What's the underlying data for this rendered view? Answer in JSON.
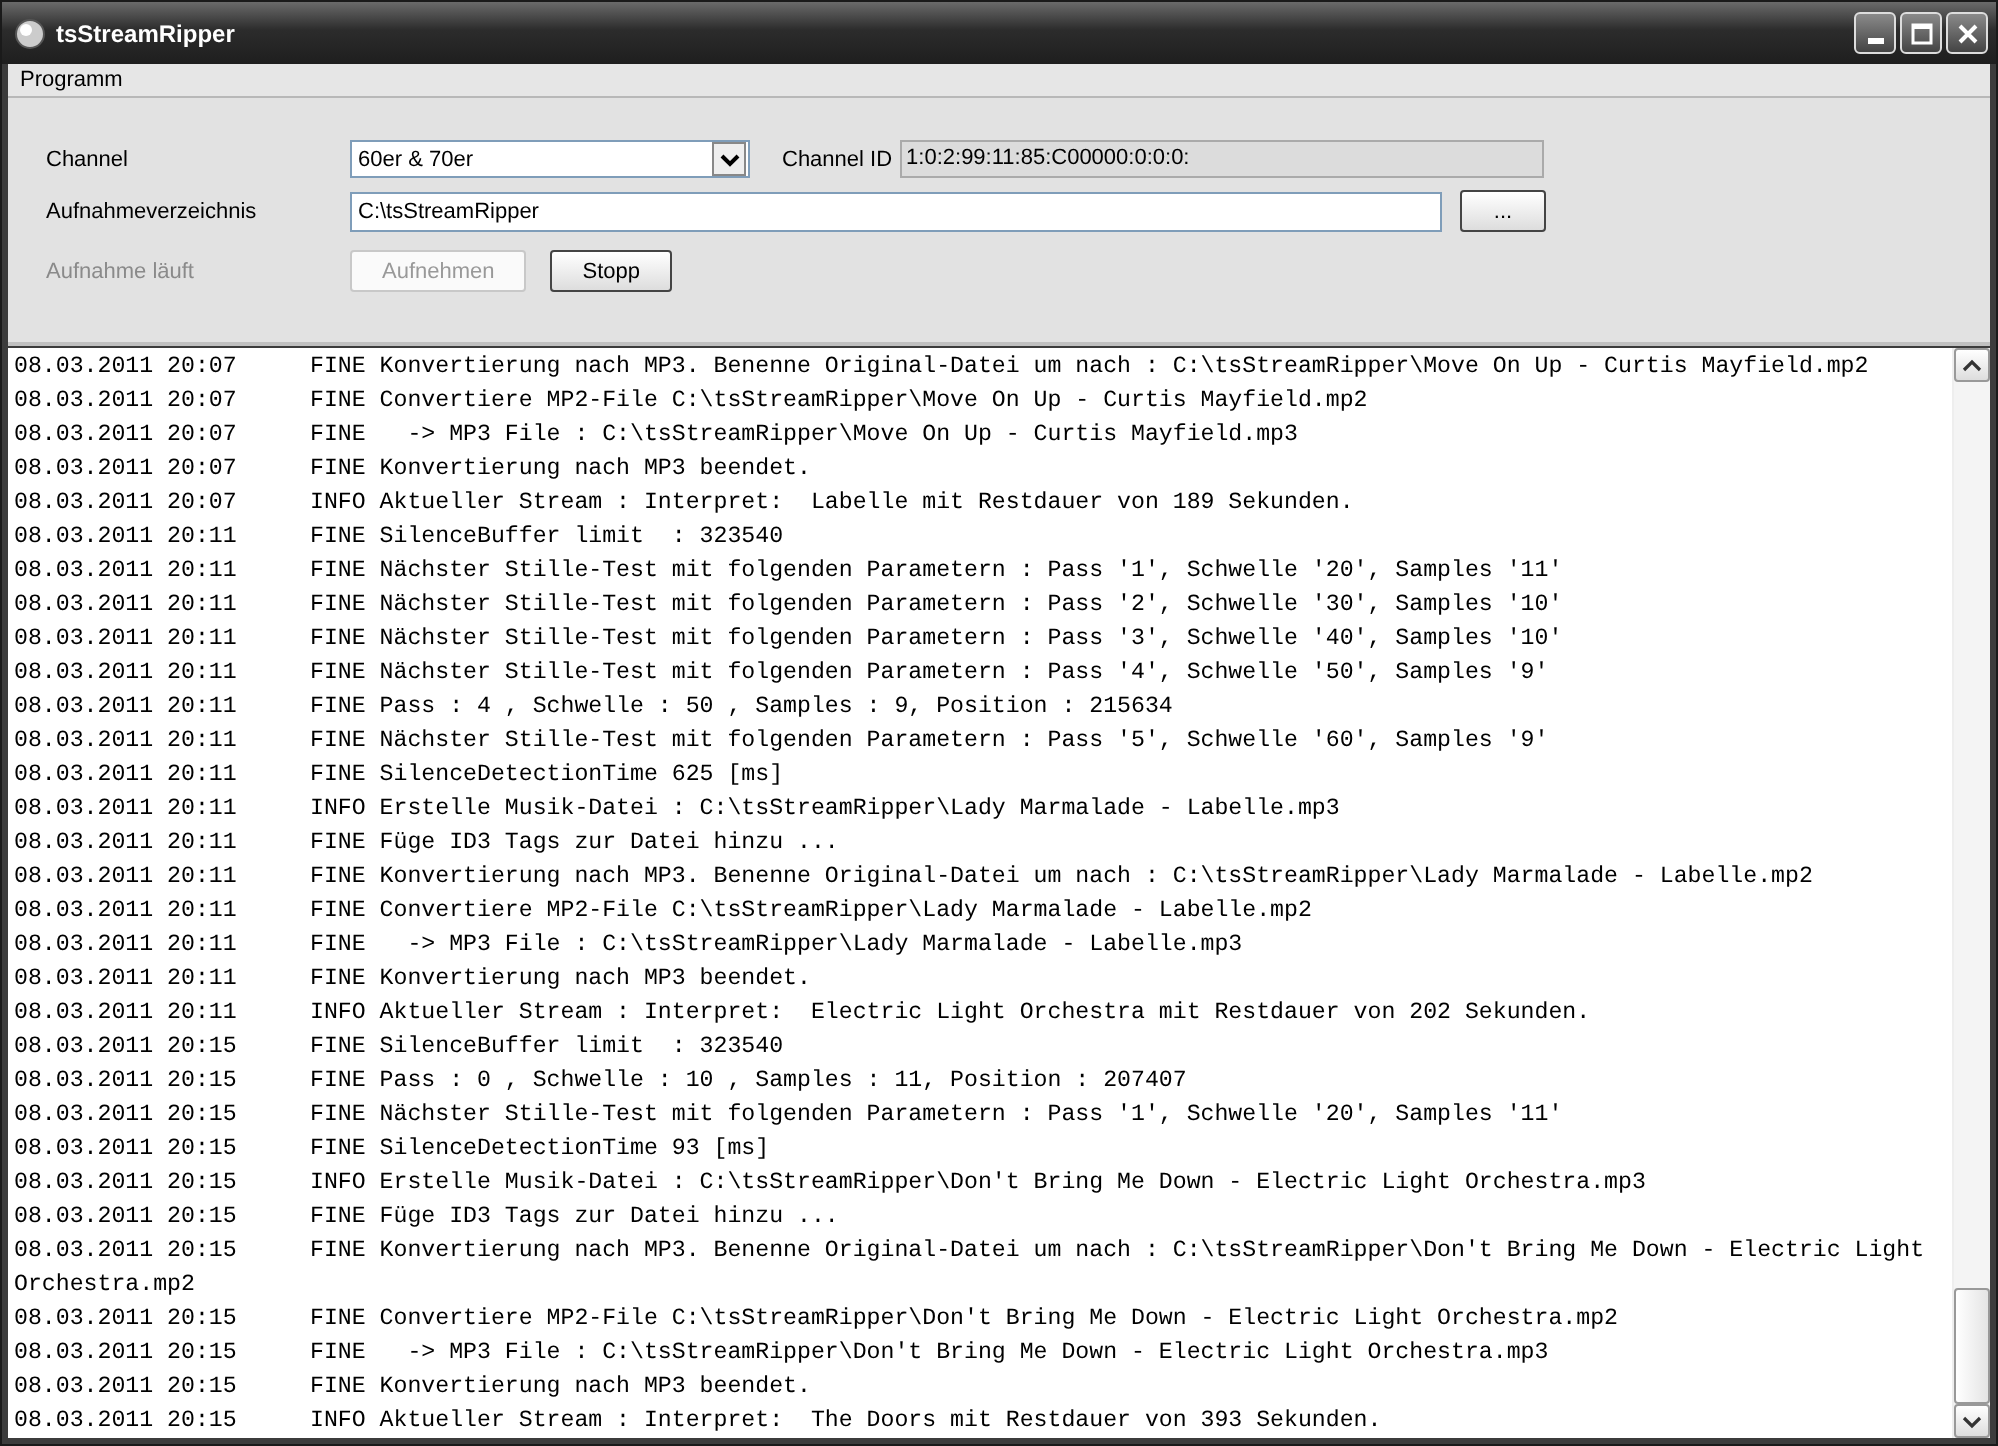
{
  "window": {
    "title": "tsStreamRipper"
  },
  "menu": [
    "Programm"
  ],
  "form": {
    "channel_label": "Channel",
    "channel_value": "60er & 70er",
    "channel_id_label": "Channel ID",
    "channel_id_value": "1:0:2:99:11:85:C00000:0:0:0:",
    "dir_label": "Aufnahmeverzeichnis",
    "dir_value": "C:\\tsStreamRipper",
    "browse_button": "...",
    "status_label": "Aufnahme läuft",
    "status_disabled": true,
    "buttons": [
      {
        "label": "Aufnehmen",
        "disabled": true
      },
      {
        "label": "Stopp",
        "disabled": false
      }
    ]
  },
  "log": [
    {
      "time": "08.03.2011 20:07",
      "message": "FINE Konvertierung nach MP3. Benenne Original-Datei um nach : C:\\tsStreamRipper\\Move On Up - Curtis Mayfield.mp2"
    },
    {
      "time": "08.03.2011 20:07",
      "message": "FINE Convertiere MP2-File C:\\tsStreamRipper\\Move On Up - Curtis Mayfield.mp2"
    },
    {
      "time": "08.03.2011 20:07",
      "message": "FINE   -> MP3 File : C:\\tsStreamRipper\\Move On Up - Curtis Mayfield.mp3"
    },
    {
      "time": "08.03.2011 20:07",
      "message": "FINE Konvertierung nach MP3 beendet."
    },
    {
      "time": "08.03.2011 20:07",
      "message": "INFO Aktueller Stream : Interpret:  Labelle mit Restdauer von 189 Sekunden."
    },
    {
      "time": "08.03.2011 20:11",
      "message": "FINE SilenceBuffer limit  : 323540"
    },
    {
      "time": "08.03.2011 20:11",
      "message": "FINE Nächster Stille-Test mit folgenden Parametern : Pass '1', Schwelle '20', Samples '11'"
    },
    {
      "time": "08.03.2011 20:11",
      "message": "FINE Nächster Stille-Test mit folgenden Parametern : Pass '2', Schwelle '30', Samples '10'"
    },
    {
      "time": "08.03.2011 20:11",
      "message": "FINE Nächster Stille-Test mit folgenden Parametern : Pass '3', Schwelle '40', Samples '10'"
    },
    {
      "time": "08.03.2011 20:11",
      "message": "FINE Nächster Stille-Test mit folgenden Parametern : Pass '4', Schwelle '50', Samples '9'"
    },
    {
      "time": "08.03.2011 20:11",
      "message": "FINE Pass : 4 , Schwelle : 50 , Samples : 9, Position : 215634"
    },
    {
      "time": "08.03.2011 20:11",
      "message": "FINE Nächster Stille-Test mit folgenden Parametern : Pass '5', Schwelle '60', Samples '9'"
    },
    {
      "time": "08.03.2011 20:11",
      "message": "FINE SilenceDetectionTime 625 [ms]"
    },
    {
      "time": "08.03.2011 20:11",
      "message": "INFO Erstelle Musik-Datei : C:\\tsStreamRipper\\Lady Marmalade - Labelle.mp3"
    },
    {
      "time": "08.03.2011 20:11",
      "message": "FINE Füge ID3 Tags zur Datei hinzu ..."
    },
    {
      "time": "08.03.2011 20:11",
      "message": "FINE Konvertierung nach MP3. Benenne Original-Datei um nach : C:\\tsStreamRipper\\Lady Marmalade - Labelle.mp2"
    },
    {
      "time": "08.03.2011 20:11",
      "message": "FINE Convertiere MP2-File C:\\tsStreamRipper\\Lady Marmalade - Labelle.mp2"
    },
    {
      "time": "08.03.2011 20:11",
      "message": "FINE   -> MP3 File : C:\\tsStreamRipper\\Lady Marmalade - Labelle.mp3"
    },
    {
      "time": "08.03.2011 20:11",
      "message": "FINE Konvertierung nach MP3 beendet."
    },
    {
      "time": "08.03.2011 20:11",
      "message": "INFO Aktueller Stream : Interpret:  Electric Light Orchestra mit Restdauer von 202 Sekunden."
    },
    {
      "time": "08.03.2011 20:15",
      "message": "FINE SilenceBuffer limit  : 323540"
    },
    {
      "time": "08.03.2011 20:15",
      "message": "FINE Pass : 0 , Schwelle : 10 , Samples : 11, Position : 207407"
    },
    {
      "time": "08.03.2011 20:15",
      "message": "FINE Nächster Stille-Test mit folgenden Parametern : Pass '1', Schwelle '20', Samples '11'"
    },
    {
      "time": "08.03.2011 20:15",
      "message": "FINE SilenceDetectionTime 93 [ms]"
    },
    {
      "time": "08.03.2011 20:15",
      "message": "INFO Erstelle Musik-Datei : C:\\tsStreamRipper\\Don't Bring Me Down - Electric Light Orchestra.mp3"
    },
    {
      "time": "08.03.2011 20:15",
      "message": "FINE Füge ID3 Tags zur Datei hinzu ..."
    },
    {
      "time": "08.03.2011 20:15",
      "message": "FINE Konvertierung nach MP3. Benenne Original-Datei um nach : C:\\tsStreamRipper\\Don't Bring Me Down - Electric Light",
      "continuation": "Orchestra.mp2"
    },
    {
      "time": "08.03.2011 20:15",
      "message": "FINE Convertiere MP2-File C:\\tsStreamRipper\\Don't Bring Me Down - Electric Light Orchestra.mp2"
    },
    {
      "time": "08.03.2011 20:15",
      "message": "FINE   -> MP3 File : C:\\tsStreamRipper\\Don't Bring Me Down - Electric Light Orchestra.mp3"
    },
    {
      "time": "08.03.2011 20:15",
      "message": "FINE Konvertierung nach MP3 beendet."
    },
    {
      "time": "08.03.2011 20:15",
      "message": "INFO Aktueller Stream : Interpret:  The Doors mit Restdauer von 393 Sekunden."
    }
  ]
}
